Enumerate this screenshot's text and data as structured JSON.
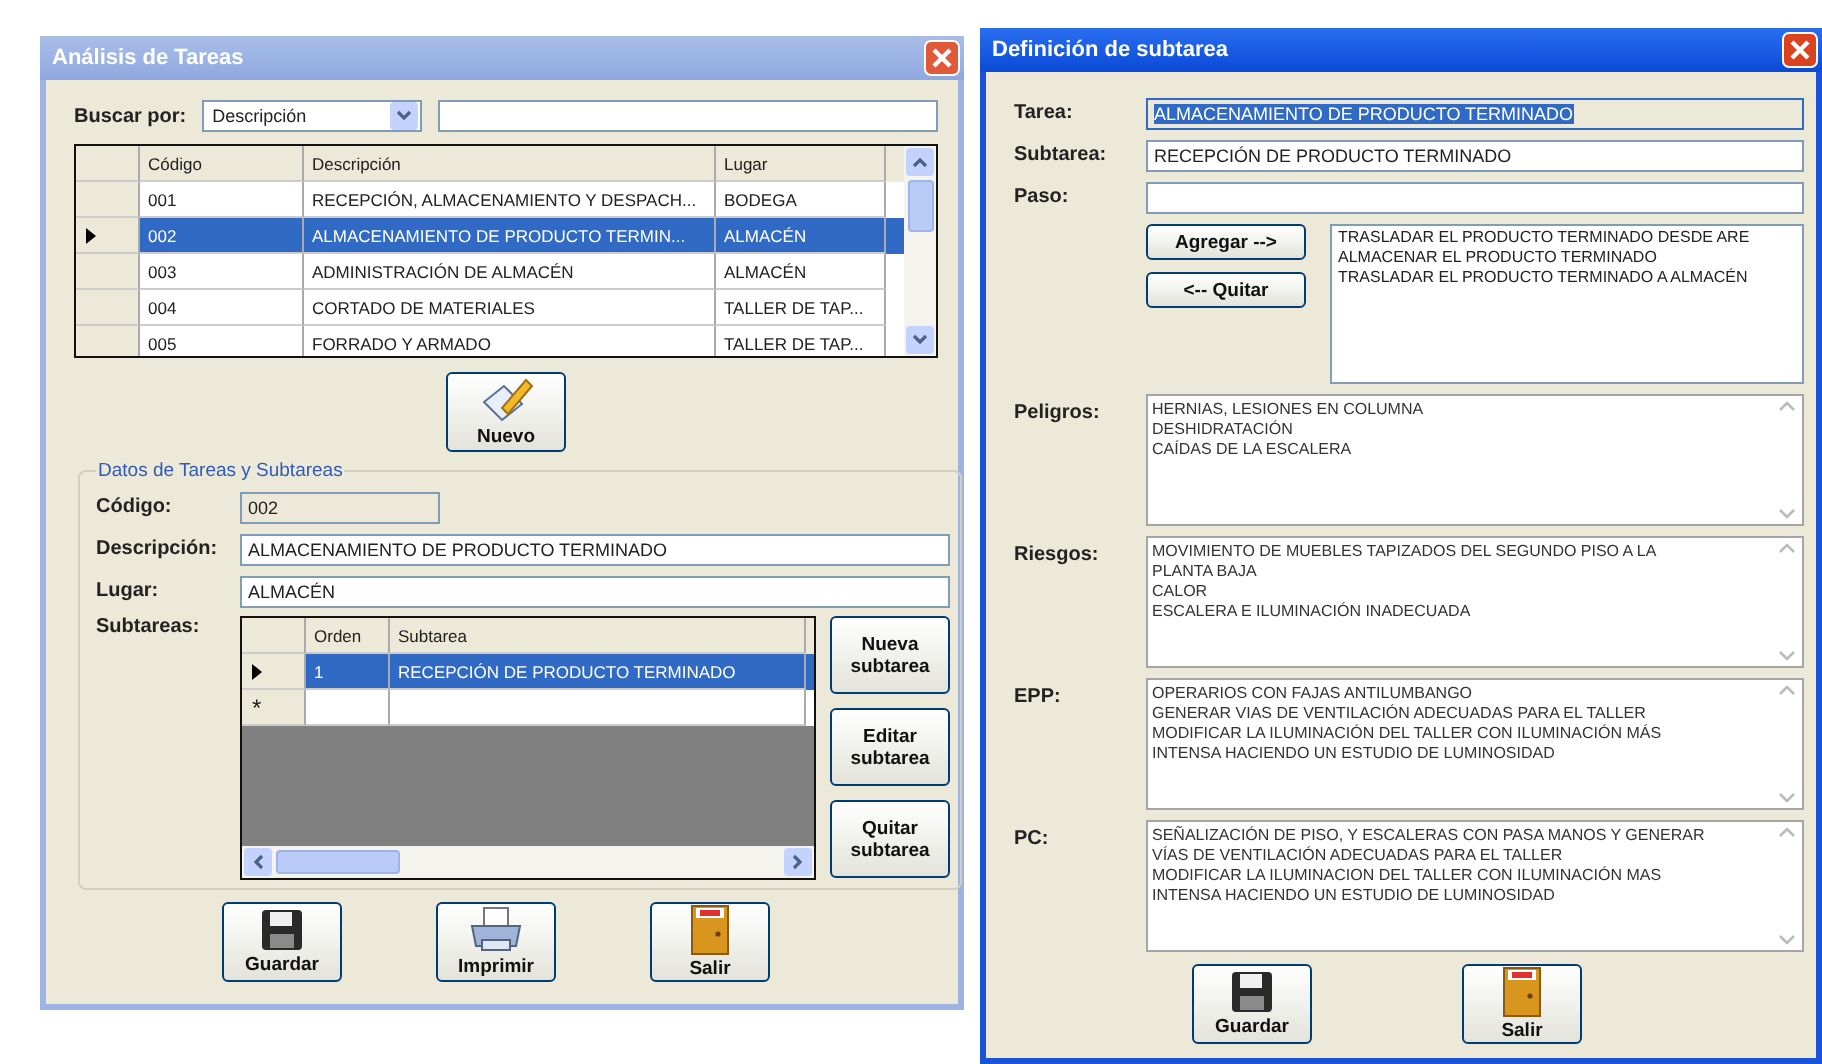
{
  "left_window": {
    "title": "Análisis de Tareas",
    "search": {
      "label": "Buscar por:",
      "field_value": "Descripción"
    },
    "tasks_grid": {
      "columns": [
        "Código",
        "Descripción",
        "Lugar"
      ],
      "rows": [
        {
          "cells": [
            "001",
            "RECEPCIÓN, ALMACENAMIENTO Y DESPACH...",
            "BODEGA"
          ],
          "selected": false
        },
        {
          "cells": [
            "002",
            "ALMACENAMIENTO DE PRODUCTO TERMIN...",
            "ALMACÉN"
          ],
          "selected": true
        },
        {
          "cells": [
            "003",
            "ADMINISTRACIÓN DE ALMACÉN",
            "ALMACÉN"
          ],
          "selected": false
        },
        {
          "cells": [
            "004",
            "CORTADO DE MATERIALES",
            "TALLER DE TAP..."
          ],
          "selected": false
        },
        {
          "cells": [
            "005",
            "FORRADO Y ARMADO",
            "TALLER DE TAP..."
          ],
          "selected": false
        }
      ]
    },
    "new_button": {
      "label": "Nuevo",
      "kind": "new"
    },
    "group": {
      "title": "Datos de Tareas y Subtareas",
      "fields": [
        {
          "label": "Código:",
          "value": "002",
          "kind": "readonly"
        },
        {
          "label": "Descripción:",
          "value": "ALMACENAMIENTO DE PRODUCTO TERMINADO",
          "kind": "text"
        },
        {
          "label": "Lugar:",
          "value": "ALMACÉN",
          "kind": "text"
        }
      ],
      "subtasks_label": "Subtareas:",
      "subtasks_grid": {
        "columns": [
          "Orden",
          "Subtarea"
        ],
        "rows": [
          {
            "cells": [
              "1",
              "RECEPCIÓN DE PRODUCTO TERMINADO"
            ],
            "selected": true
          }
        ],
        "new_row_marker": "*"
      },
      "side_buttons": [
        "Nueva subtarea",
        "Editar subtarea",
        "Quitar subtarea"
      ]
    },
    "bottom_buttons": [
      {
        "label": "Guardar",
        "kind": "save"
      },
      {
        "label": "Imprimir",
        "kind": "print"
      },
      {
        "label": "Salir",
        "kind": "exit"
      }
    ]
  },
  "right_window": {
    "title": "Definición de subtarea",
    "fields": [
      {
        "label": "Tarea:",
        "value": "ALMACENAMIENTO DE PRODUCTO TERMINADO",
        "kind": "readonly",
        "highlighted": true
      },
      {
        "label": "Subtarea:",
        "value": "RECEPCIÓN DE PRODUCTO TERMINADO",
        "kind": "text",
        "highlighted": false
      },
      {
        "label": "Paso:",
        "kind": "text",
        "highlighted": false
      }
    ],
    "step_buttons": [
      "Agregar -->",
      "<-- Quitar"
    ],
    "steps": [
      "TRASLADAR EL PRODUCTO TERMINADO DESDE ARE",
      "ALMACENAR EL PRODUCTO TERMINADO",
      "TRASLADAR EL PRODUCTO TERMINADO A ALMACÉN"
    ],
    "memos": [
      {
        "label": "Peligros:",
        "lines": [
          "HERNIAS, LESIONES EN COLUMNA",
          "DESHIDRATACIÓN",
          "CAÍDAS DE LA ESCALERA"
        ]
      },
      {
        "label": "Riesgos:",
        "lines": [
          "MOVIMIENTO DE MUEBLES TAPIZADOS DEL SEGUNDO PISO A LA",
          "PLANTA BAJA",
          "CALOR",
          "ESCALERA E ILUMINACIÓN INADECUADA"
        ]
      },
      {
        "label": "EPP:",
        "lines": [
          "OPERARIOS CON FAJAS ANTILUMBANGO",
          "GENERAR VIAS DE VENTILACIÓN ADECUADAS PARA EL TALLER",
          "MODIFICAR LA ILUMINACIÓN DEL TALLER CON ILUMINACIÓN MÁS",
          "INTENSA HACIENDO  UN ESTUDIO DE LUMINOSIDAD"
        ]
      },
      {
        "label": "PC:",
        "lines": [
          "SEÑALIZACIÓN DE PISO, Y ESCALERAS CON PASA MANOS Y GENERAR",
          "VÍAS DE VENTILACIÓN ADECUADAS PARA EL TALLER",
          "MODIFICAR LA ILUMINACION DEL TALLER CON ILUMINACIÓN MAS",
          "INTENSA HACIENDO  UN ESTUDIO DE LUMINOSIDAD"
        ]
      }
    ],
    "bottom_buttons": [
      {
        "label": "Guardar",
        "kind": "save"
      },
      {
        "label": "Salir",
        "kind": "exit"
      }
    ]
  }
}
